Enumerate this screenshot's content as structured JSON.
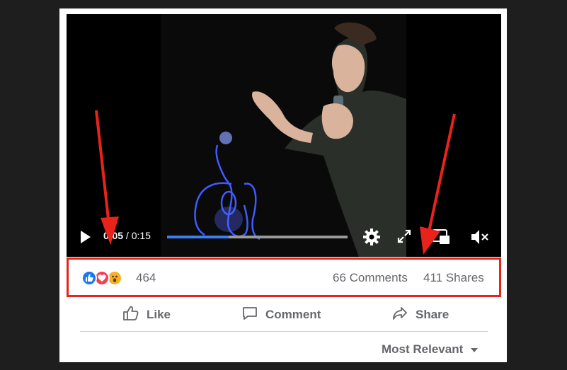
{
  "video": {
    "current_time": "0:05",
    "separator": " / ",
    "duration": "0:15",
    "progress": 0.34,
    "controls": {
      "play_icon": "play-icon",
      "settings_icon": "gear-icon",
      "fullscreen_icon": "expand-icon",
      "cast_icon": "cast-icon",
      "mute_icon": "speaker-muted-icon"
    }
  },
  "post_stats": {
    "reactions": [
      "like",
      "love",
      "wow"
    ],
    "reaction_count": "464",
    "comments": "66 Comments",
    "shares": "411 Shares"
  },
  "actions": {
    "like": "Like",
    "comment": "Comment",
    "share": "Share"
  },
  "comments_sort": {
    "label": "Most Relevant"
  },
  "colors": {
    "annotation": "#e8231a",
    "progress_fill": "#3b7ff0",
    "like_blue": "#1877f2",
    "love_red": "#f33e58",
    "wow_yellow": "#f7b125"
  }
}
